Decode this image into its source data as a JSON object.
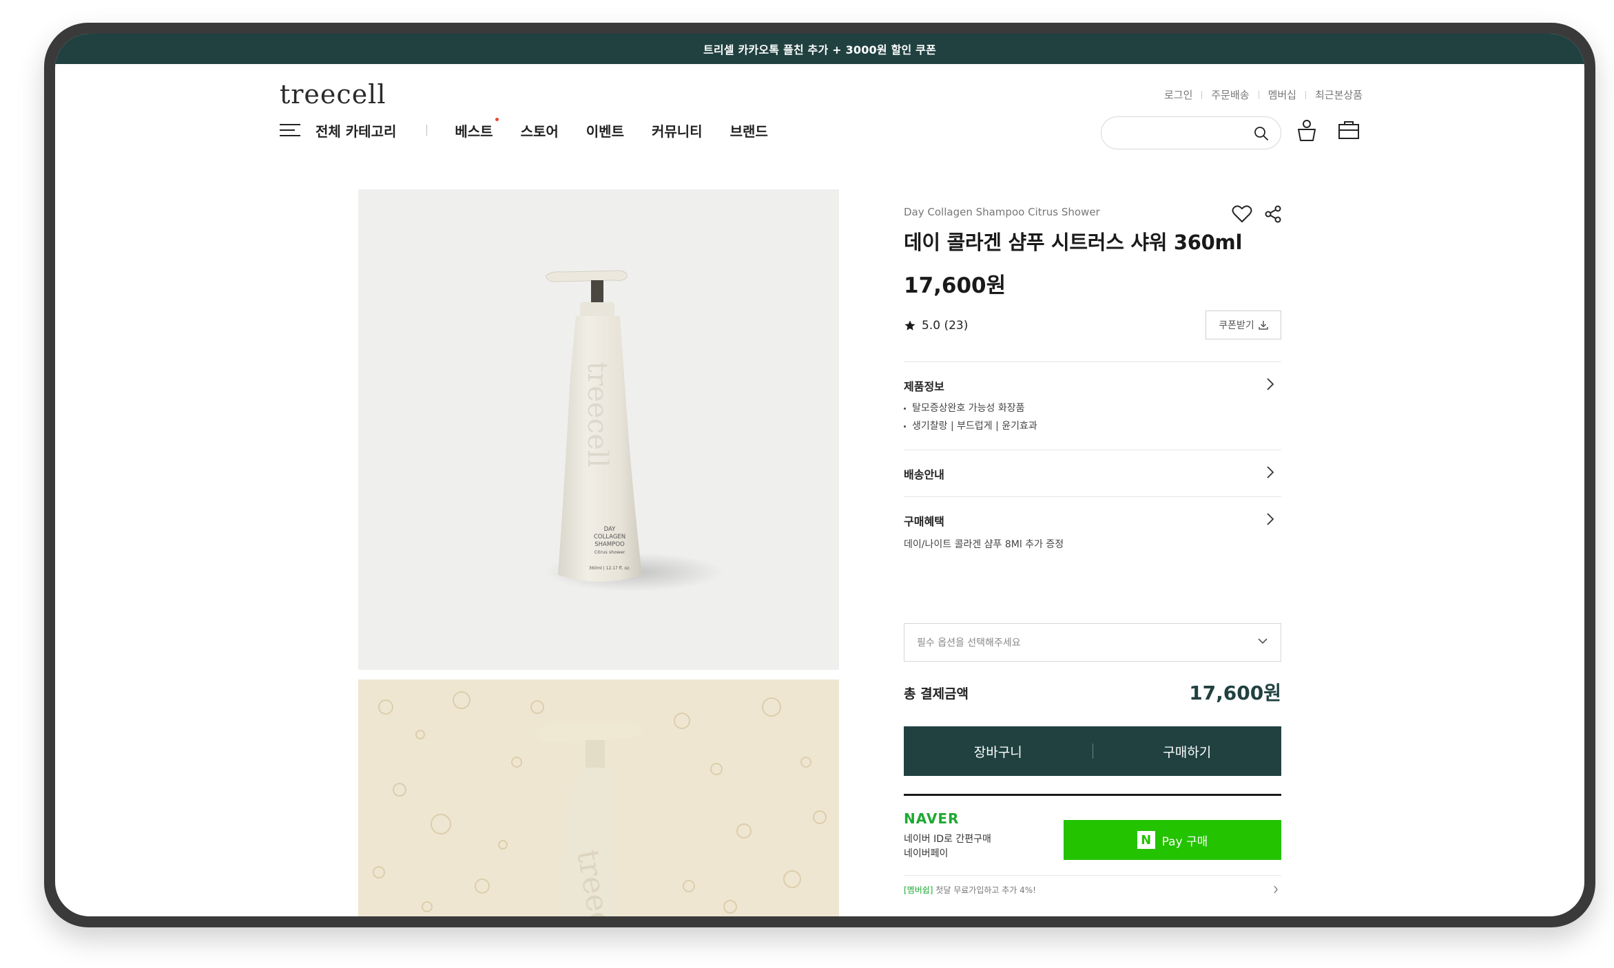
{
  "banner": {
    "text": "트리셀 카카오톡 플친 추가 + 3000원 할인 쿠폰"
  },
  "header": {
    "logo": "treecell",
    "util_links": [
      "로그인",
      "주문배송",
      "멤버십",
      "최근본상품"
    ],
    "all_category": "전체 카테고리",
    "nav": [
      "베스트",
      "스토어",
      "이벤트",
      "커뮤니티",
      "브랜드"
    ],
    "search": {
      "placeholder": ""
    }
  },
  "product": {
    "name_en": "Day Collagen Shampoo Citrus Shower",
    "name_ko": "데이 콜라겐 샴푸 시트러스 샤워 360ml",
    "price": "17,600원",
    "rating": "5.0 (23)",
    "coupon_label": "쿠폰받기",
    "bottle_label": [
      "DAY",
      "COLLAGEN",
      "SHAMPOO",
      "Citrus shower",
      "360ml | 12.17 fl. oz."
    ]
  },
  "sections": {
    "info": {
      "title": "제품정보",
      "lines": [
        "탈모증상완호 가능성 화장품",
        "생기찰랑 | 부드럽게 | 윤기효과"
      ]
    },
    "shipping": {
      "title": "배송안내"
    },
    "benefit": {
      "title": "구매혜택",
      "desc": "데이/나이트 콜라겐 샴푸 8Ml 추가 증정"
    }
  },
  "option": {
    "placeholder": "필수 옵션을 선택해주세요"
  },
  "total": {
    "label": "총 결제금액",
    "value": "17,600원"
  },
  "buttons": {
    "cart": "장바구니",
    "buy": "구매하기"
  },
  "naver": {
    "logo": "NAVER",
    "sub1": "네이버 ID로 간편구매",
    "sub2": "네이버페이",
    "pay_n": "N",
    "pay_label": "Pay 구매",
    "footer_tag": "[멤버쉽]",
    "footer_text": " 첫달 무료가입하고 추가 4%!"
  },
  "colors": {
    "brand": "#214141",
    "naver_green": "#23c300",
    "accent_dot": "#e8492f"
  }
}
